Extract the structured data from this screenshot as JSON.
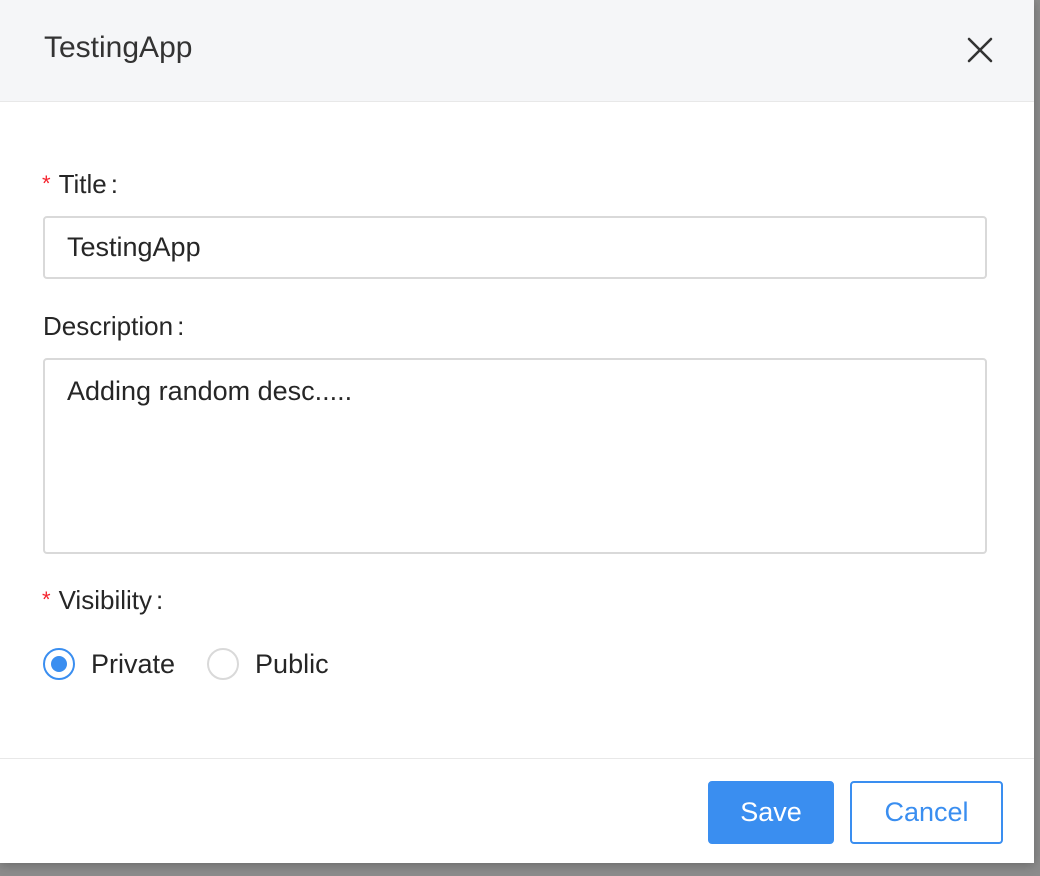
{
  "modal": {
    "title": "TestingApp",
    "close_icon": "close-icon"
  },
  "form": {
    "title": {
      "label": "Title",
      "required": true,
      "value": "TestingApp"
    },
    "description": {
      "label": "Description",
      "required": false,
      "value": "Adding random desc....."
    },
    "visibility": {
      "label": "Visibility",
      "required": true,
      "options": [
        {
          "label": "Private",
          "checked": true
        },
        {
          "label": "Public",
          "checked": false
        }
      ]
    },
    "required_mark": "*",
    "colon": ":"
  },
  "footer": {
    "save_label": "Save",
    "cancel_label": "Cancel"
  },
  "colors": {
    "primary": "#3a8ef0",
    "required": "#f5222d",
    "header_bg": "#f5f6f8",
    "border": "#d9d9d9"
  }
}
